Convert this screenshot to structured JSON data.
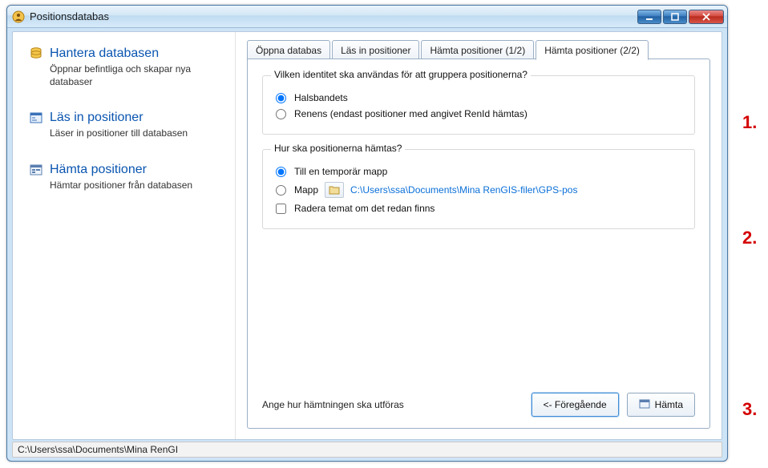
{
  "window": {
    "title": "Positionsdatabas"
  },
  "sidebar": {
    "items": [
      {
        "title": "Hantera databasen",
        "desc": "Öppnar befintliga och skapar nya databaser"
      },
      {
        "title": "Läs in positioner",
        "desc": "Läser in positioner till databasen"
      },
      {
        "title": "Hämta positioner",
        "desc": "Hämtar positioner från databasen"
      }
    ]
  },
  "tabs": {
    "items": [
      {
        "label": "Öppna databas"
      },
      {
        "label": "Läs in positioner"
      },
      {
        "label": "Hämta positioner (1/2)"
      },
      {
        "label": "Hämta positioner (2/2)"
      }
    ],
    "activeIndex": 3
  },
  "page": {
    "identityGroup": {
      "title": "Vilken identitet ska användas för att gruppera positionerna?",
      "opt1": "Halsbandets",
      "opt2": "Renens (endast positioner med angivet RenId hämtas)",
      "selected": "opt1"
    },
    "fetchGroup": {
      "title": "Hur ska positionerna hämtas?",
      "optTemp": "Till en temporär mapp",
      "optFolder": "Mapp",
      "folderPath": "C:\\Users\\ssa\\Documents\\Mina RenGIS-filer\\GPS-pos",
      "deleteTheme": "Radera temat om det redan finns",
      "selected": "optTemp"
    },
    "hint": "Ange hur hämtningen ska utföras",
    "prevBtn": "<- Föregående",
    "fetchBtn": "Hämta"
  },
  "statusbar": {
    "text": "C:\\Users\\ssa\\Documents\\Mina RenGI"
  },
  "annotations": {
    "a1": "1.",
    "a2": "2.",
    "a3": "3."
  }
}
